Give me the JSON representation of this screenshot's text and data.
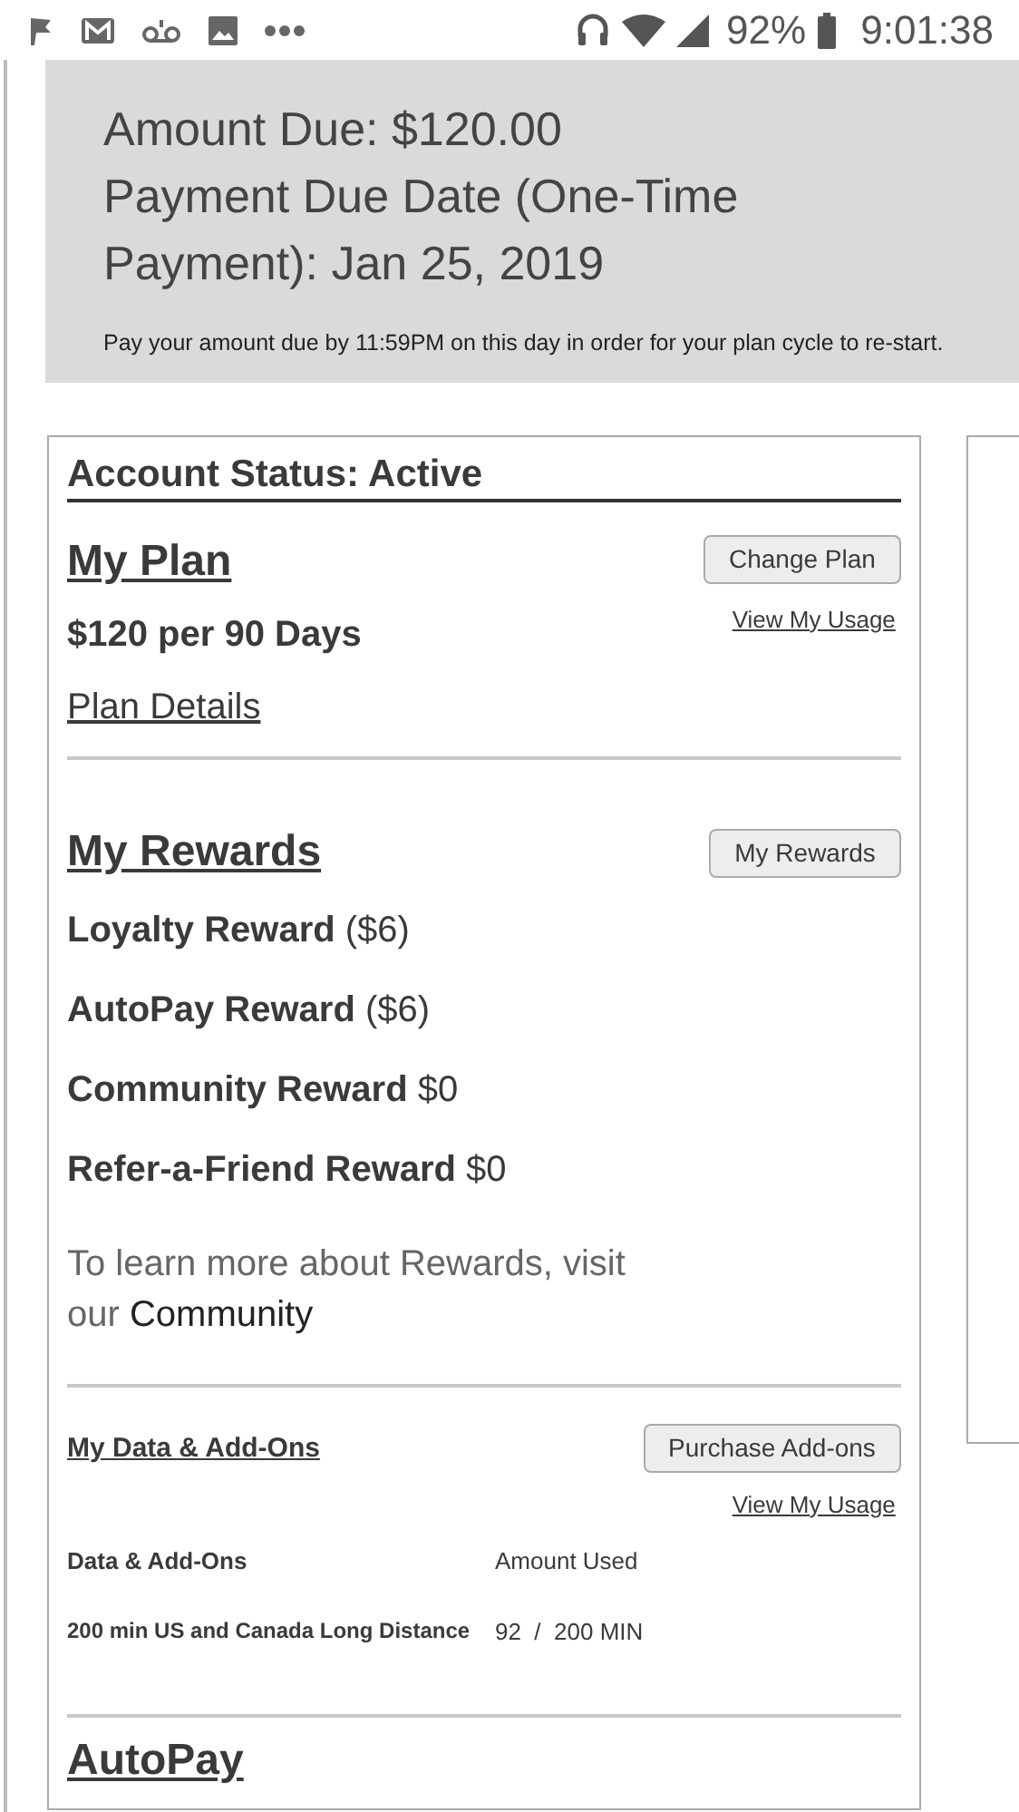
{
  "status_bar": {
    "battery": "92%",
    "time": "9:01:38"
  },
  "banner": {
    "lines": [
      "Amount Due: $120.00",
      "Payment Due Date (One-Time Payment): Jan 25, 2019"
    ],
    "note": "Pay your amount due by 11:59PM on this day in order for your plan cycle to re-start."
  },
  "account": {
    "status": "Account Status: Active",
    "plan": {
      "title": "My Plan",
      "button": "Change Plan",
      "usage_link": "View My Usage",
      "price": "$120 per 90 Days",
      "details_link": "Plan Details"
    },
    "rewards": {
      "title": "My Rewards",
      "button": "My Rewards",
      "items": [
        {
          "text": "**Loyalty Reward** ($6)"
        },
        {
          "text": "**AutoPay Reward** ($6)"
        },
        {
          "text": "**Community Reward** $0"
        },
        {
          "text": "**Refer-a-Friend Reward** $0"
        }
      ],
      "info": "To learn more about Rewards, visit our",
      "info_link": "Community"
    },
    "data": {
      "title": "My Data & Add-Ons",
      "button": "Purchase Add-ons",
      "usage_link": "View My Usage",
      "columns": [
        "Data & Add-Ons",
        "Amount Used"
      ],
      "rows": [
        {
          "name": "200 min US and Canada Long Distance",
          "used": "92  /  200 MIN"
        }
      ]
    },
    "autopay": {
      "title": "AutoPay"
    }
  }
}
